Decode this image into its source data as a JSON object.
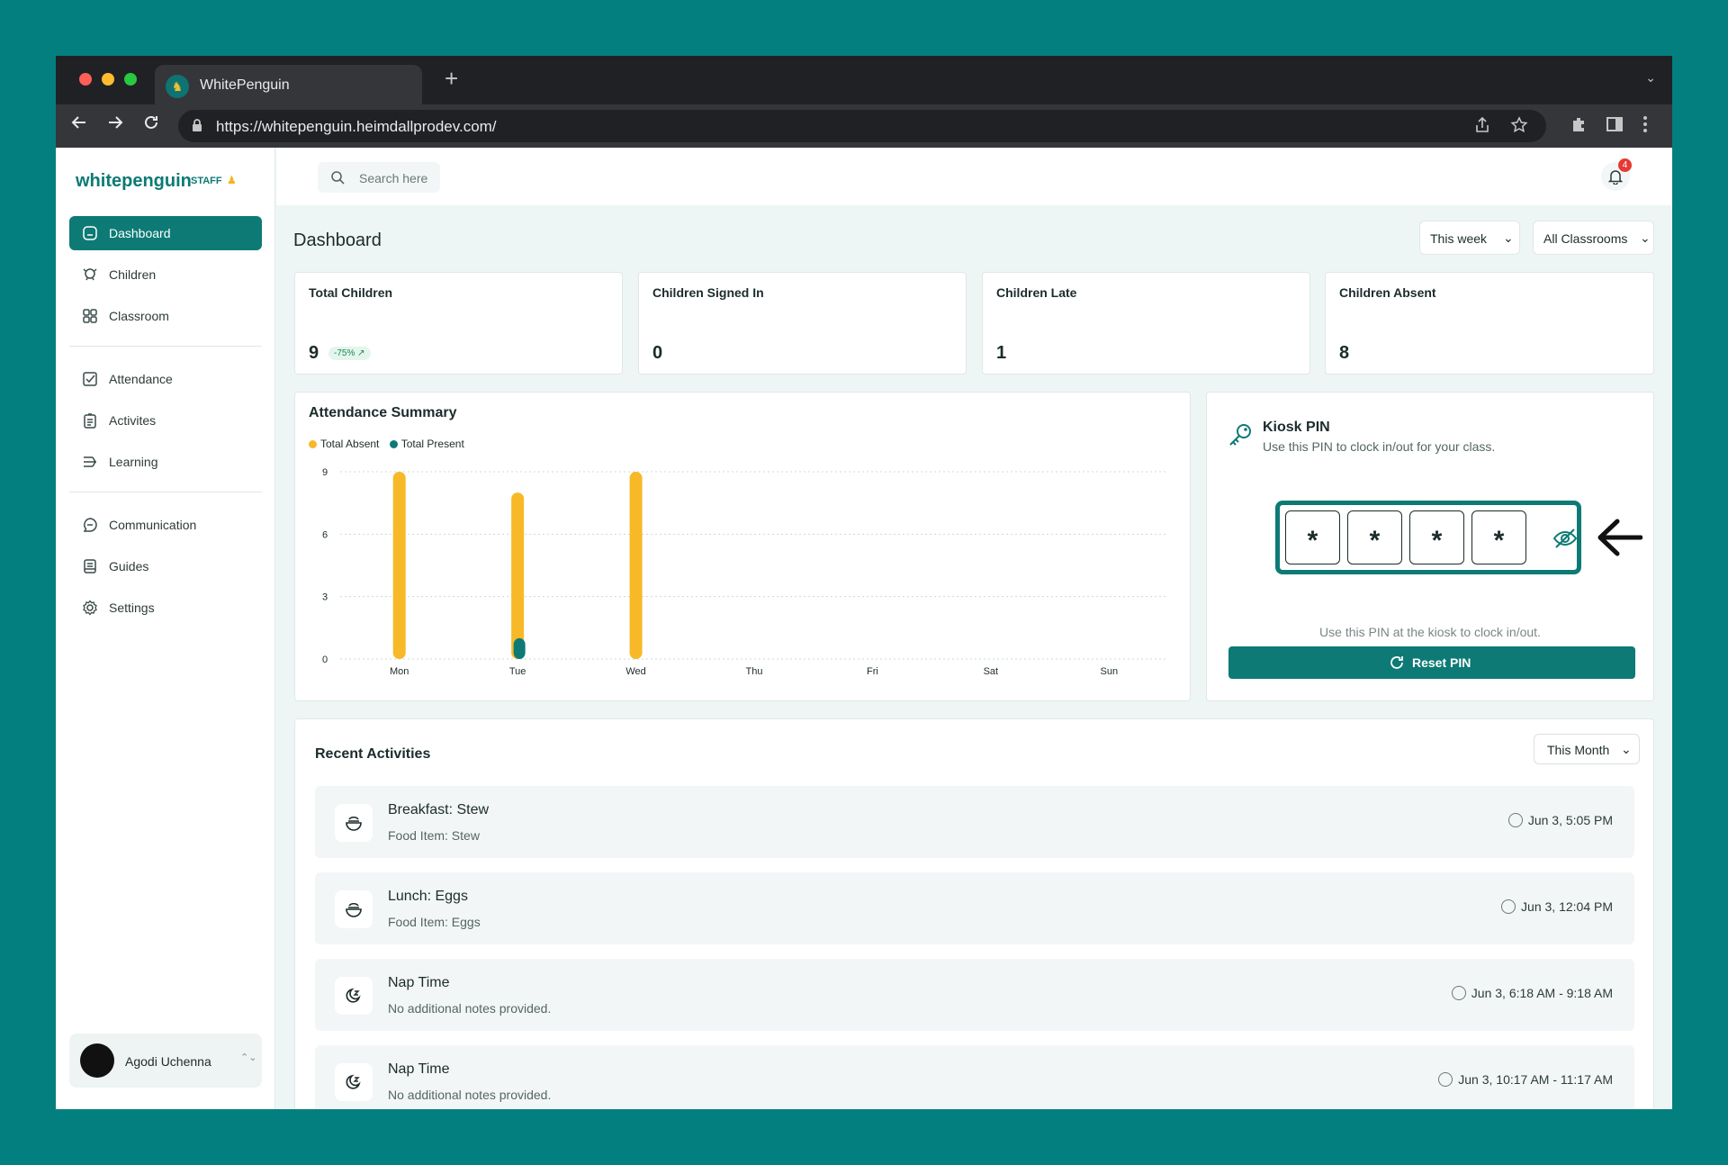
{
  "browser": {
    "tab_title": "WhitePenguin",
    "url": "https://whitepenguin.heimdallprodev.com/"
  },
  "brand": {
    "logo": "whitepenguin",
    "role": "STAFF"
  },
  "sidebar": {
    "items": [
      {
        "label": "Dashboard",
        "icon": "dashboard-icon",
        "active": true
      },
      {
        "label": "Children",
        "icon": "children-icon"
      },
      {
        "label": "Classroom",
        "icon": "classroom-grid-icon"
      },
      {
        "label": "Attendance",
        "icon": "attendance-check-icon"
      },
      {
        "label": "Activites",
        "icon": "activities-clipboard-icon"
      },
      {
        "label": "Learning",
        "icon": "learning-icon"
      },
      {
        "label": "Communication",
        "icon": "chat-icon"
      },
      {
        "label": "Guides",
        "icon": "guides-book-icon"
      },
      {
        "label": "Settings",
        "icon": "settings-gear-icon"
      }
    ],
    "user": {
      "name": "Agodi Uchenna"
    }
  },
  "topbar": {
    "search_placeholder": "Search here",
    "notification_count": "4"
  },
  "page": {
    "title": "Dashboard",
    "period_filter": "This week",
    "classroom_filter": "All Classrooms"
  },
  "stats": [
    {
      "label": "Total Children",
      "value": "9",
      "change": "-75% ↗"
    },
    {
      "label": "Children Signed In",
      "value": "0"
    },
    {
      "label": "Children Late",
      "value": "1"
    },
    {
      "label": "Children Absent",
      "value": "8"
    }
  ],
  "colors": {
    "accent": "#0d7a75",
    "absent": "#f7b928",
    "present": "#0d7a75"
  },
  "chart_data": {
    "type": "bar",
    "title": "Attendance Summary",
    "categories": [
      "Mon",
      "Tue",
      "Wed",
      "Thu",
      "Fri",
      "Sat",
      "Sun"
    ],
    "series": [
      {
        "name": "Total Absent",
        "values": [
          9,
          8,
          9,
          0,
          0,
          0,
          0
        ]
      },
      {
        "name": "Total Present",
        "values": [
          0,
          1,
          0,
          0,
          0,
          0,
          0
        ]
      }
    ],
    "yticks": [
      0,
      3,
      6,
      9
    ],
    "ylim": [
      0,
      9
    ],
    "grid": true,
    "legend": "top-left"
  },
  "kiosk": {
    "title": "Kiosk PIN",
    "subtitle": "Use this PIN to clock in/out for your class.",
    "digits": [
      "*",
      "*",
      "*",
      "*"
    ],
    "note": "Use this PIN at the kiosk to clock in/out.",
    "reset_label": "Reset PIN"
  },
  "activities": {
    "title": "Recent Activities",
    "filter": "This Month",
    "items": [
      {
        "name": "Breakfast: Stew",
        "desc": "Food Item: Stew",
        "time": "Jun 3, 5:05 PM",
        "icon": "food-bowl-icon"
      },
      {
        "name": "Lunch: Eggs",
        "desc": "Food Item: Eggs",
        "time": "Jun 3, 12:04 PM",
        "icon": "food-bowl-icon"
      },
      {
        "name": "Nap Time",
        "desc": "No additional notes provided.",
        "time": "Jun 3, 6:18 AM - 9:18 AM",
        "icon": "nap-moon-icon"
      },
      {
        "name": "Nap Time",
        "desc": "No additional notes provided.",
        "time": "Jun 3, 10:17 AM - 11:17 AM",
        "icon": "nap-moon-icon"
      }
    ]
  }
}
